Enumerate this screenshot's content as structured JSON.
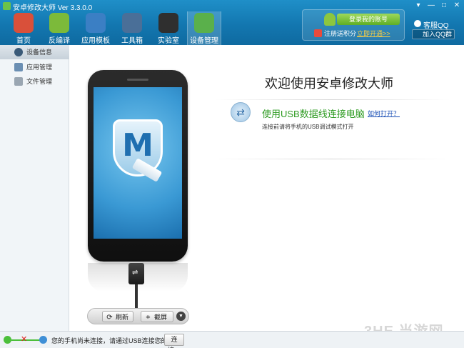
{
  "window": {
    "title": "安卓修改大师 Ver 3.3.0.0",
    "controls": [
      "▾",
      "—",
      "□",
      "✕"
    ]
  },
  "toolbar": {
    "items": [
      {
        "label": "首页",
        "icon": "house-icon",
        "color": "#d9503a"
      },
      {
        "label": "反编译",
        "icon": "android-icon",
        "color": "#7cba3a"
      },
      {
        "label": "应用模板",
        "icon": "star-icon",
        "color": "#3b7fc4"
      },
      {
        "label": "工具箱",
        "icon": "toolbox-icon",
        "color": "#4a6f98"
      },
      {
        "label": "实验室",
        "icon": "flask-icon",
        "color": "#2f2f2f"
      },
      {
        "label": "设备管理",
        "icon": "device-icon",
        "color": "#5ab04b"
      }
    ],
    "active_index": 5
  },
  "account": {
    "login_label": "登录我的账号",
    "register_text": "注册送积分",
    "register_link": "立即开通>>",
    "support_label": "客服QQ",
    "qq_group_label": "加入QQ群"
  },
  "sidebar": {
    "items": [
      {
        "label": "设备信息",
        "icon": "info-icon"
      },
      {
        "label": "应用管理",
        "icon": "app-icon"
      },
      {
        "label": "文件管理",
        "icon": "file-icon"
      }
    ],
    "active_index": 0
  },
  "main": {
    "welcome": "欢迎使用安卓修改大师",
    "usb_title": "使用USB数据线连接电脑",
    "howto_link": "如何打开？",
    "usb_subtitle": "连接前请将手机的USB调试模式打开",
    "phone_logo": "M",
    "refresh_label": "刷新",
    "screenshot_label": "截屏"
  },
  "statusbar": {
    "message": "您的手机尚未连接，请通过USB连接您的设备。",
    "connect_label": "连接。"
  },
  "watermark": "3HE 当游网"
}
